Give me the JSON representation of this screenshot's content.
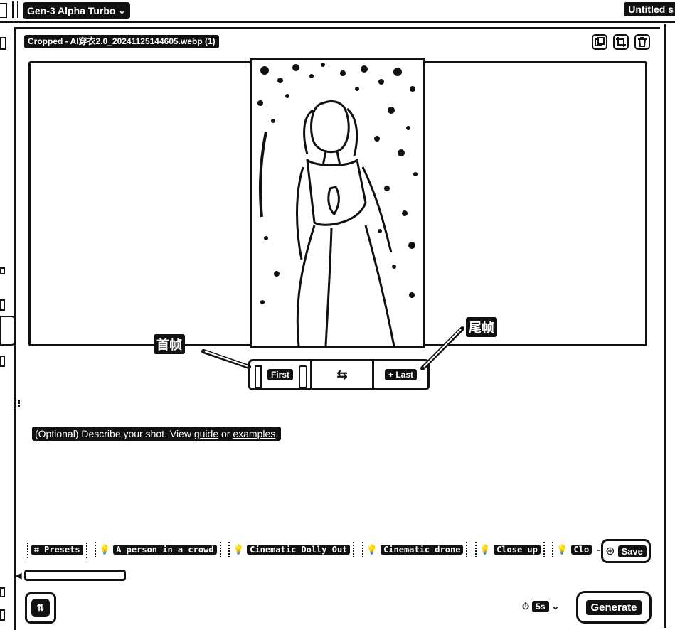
{
  "header": {
    "model_label": "Gen-3 Alpha Turbo",
    "model_chevron_icon": "chevron-down-icon",
    "project_title": "Untitled s"
  },
  "asset": {
    "file_name": "Cropped - AI穿衣2.0_20241125144605.webp (1)",
    "tools": [
      "copy-icon",
      "crop-icon",
      "trash-icon"
    ]
  },
  "frames": {
    "first_label": "First",
    "swap_icon": "swap-arrows-icon",
    "last_label": "+ Last"
  },
  "annotations": {
    "first_frame_callout": "首帧",
    "last_frame_callout": "尾帧"
  },
  "prompt": {
    "hint_prefix": "(Optional) Describe your shot. View ",
    "guide_link": "guide",
    "hint_middle": " or ",
    "examples_link": "examples",
    "hint_suffix": "."
  },
  "chips": {
    "presets_label": "Presets",
    "suggestions": [
      "A person in a crowd",
      "Cinematic Dolly Out",
      "Cinematic drone",
      "Close up",
      "Clo"
    ]
  },
  "save_label": "Save",
  "footer": {
    "duration_value": "5s",
    "generate_label": "Generate"
  },
  "colors": {
    "ink": "#111111",
    "paper": "#ffffff"
  }
}
